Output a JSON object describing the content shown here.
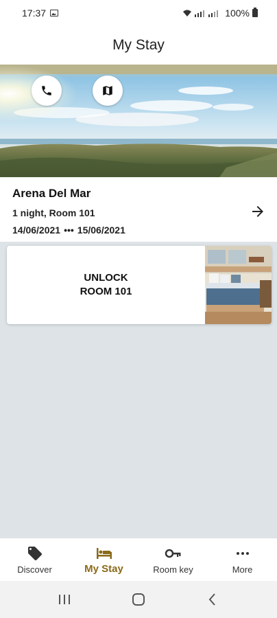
{
  "status_bar": {
    "time": "17:37",
    "signal_text": "100%",
    "icons": [
      "image-icon",
      "wifi-icon",
      "signal-icon",
      "battery-icon"
    ]
  },
  "header": {
    "title": "My Stay"
  },
  "hero": {
    "buttons": [
      {
        "name": "call",
        "icon": "phone-icon"
      },
      {
        "name": "map",
        "icon": "map-icon"
      }
    ]
  },
  "stay": {
    "hotel_name": "Arena Del Mar",
    "details": "1 night, Room 101",
    "check_in": "14/06/2021",
    "separator": "•••",
    "check_out": "15/06/2021"
  },
  "unlock_card": {
    "line1": "UNLOCK",
    "line2": "ROOM 101"
  },
  "bottom_nav": {
    "items": [
      {
        "label": "Discover",
        "icon": "tag-icon",
        "active": false
      },
      {
        "label": "My Stay",
        "icon": "bed-icon",
        "active": true
      },
      {
        "label": "Room key",
        "icon": "key-icon",
        "active": false
      },
      {
        "label": "More",
        "icon": "more-dots-icon",
        "active": false
      }
    ]
  },
  "colors": {
    "accent": "#8a6a1a",
    "background": "#dde3e6",
    "card": "#ffffff"
  }
}
